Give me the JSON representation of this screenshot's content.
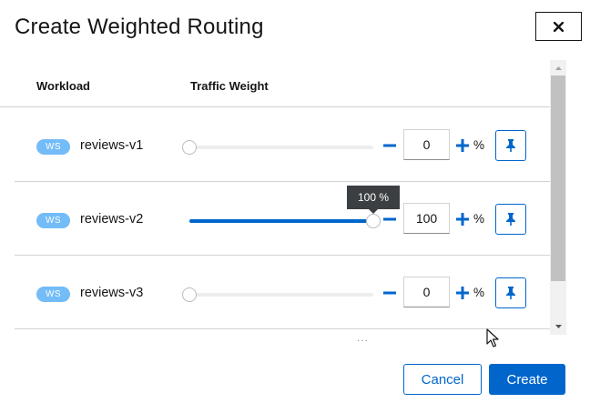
{
  "dialog": {
    "title": "Create Weighted Routing"
  },
  "table": {
    "columns": [
      "Workload",
      "Traffic Weight"
    ],
    "rows": [
      {
        "badge": "WS",
        "name": "reviews-v1",
        "weight": 0,
        "value": "0",
        "unit": "%"
      },
      {
        "badge": "WS",
        "name": "reviews-v2",
        "weight": 100,
        "value": "100",
        "unit": "%",
        "tooltip": "100 %"
      },
      {
        "badge": "WS",
        "name": "reviews-v3",
        "weight": 0,
        "value": "0",
        "unit": "%"
      }
    ]
  },
  "footer": {
    "cancel_label": "Cancel",
    "create_label": "Create"
  },
  "colors": {
    "accent": "#0066cc",
    "badge": "#73bcf7",
    "tooltip_bg": "#3c3f42"
  },
  "icons": {
    "close": "close-icon",
    "minus": "minus-icon",
    "plus": "plus-icon",
    "pin": "pin-icon"
  }
}
